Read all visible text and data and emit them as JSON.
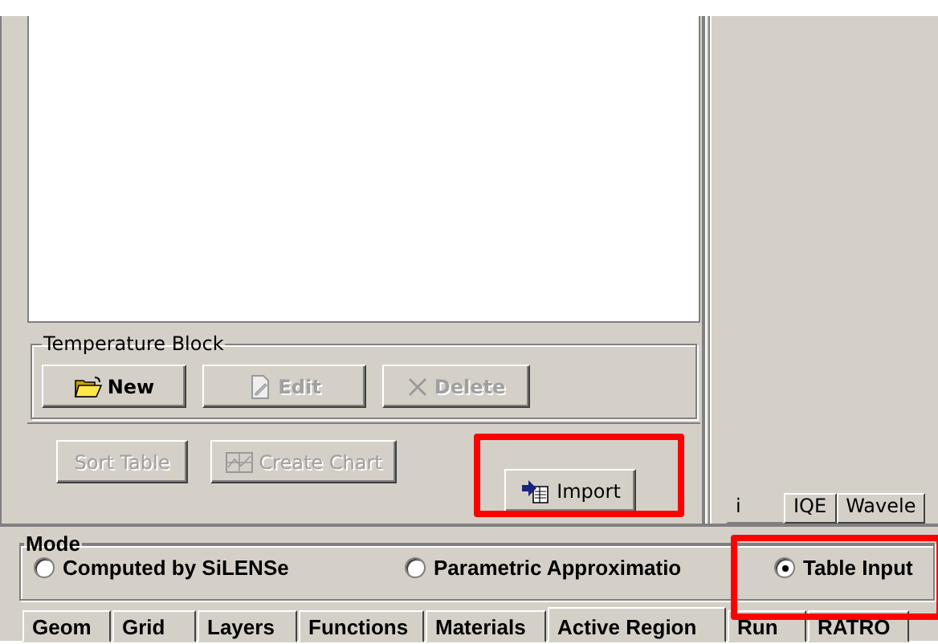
{
  "temperature_block": {
    "title": "Temperature Block",
    "buttons": [
      {
        "label": "New",
        "disabled": false
      },
      {
        "label": "Edit",
        "disabled": true
      },
      {
        "label": "Delete",
        "disabled": true
      }
    ]
  },
  "table_buttons": [
    {
      "label": "Sort Table",
      "disabled": true
    },
    {
      "label": "Create Chart",
      "disabled": true
    },
    {
      "label": "Import",
      "disabled": false
    }
  ],
  "result_tabs": [
    {
      "label": "i",
      "selected": true
    },
    {
      "label": "IQE",
      "selected": false
    },
    {
      "label": "Wavele",
      "selected": false
    }
  ],
  "mode": {
    "title": "Mode",
    "options": [
      {
        "label": "Computed by SiLENSe",
        "selected": false
      },
      {
        "label": "Parametric Approximatio",
        "selected": false
      },
      {
        "label": "Table Input",
        "selected": true
      }
    ]
  },
  "tabs": [
    {
      "label": "Geom",
      "selected": false
    },
    {
      "label": "Grid",
      "selected": false
    },
    {
      "label": "Layers",
      "selected": false
    },
    {
      "label": "Functions",
      "selected": false
    },
    {
      "label": "Materials",
      "selected": false
    },
    {
      "label": "Active Region",
      "selected": true
    },
    {
      "label": "Run",
      "selected": false
    },
    {
      "label": "RATRO",
      "selected": false
    }
  ]
}
